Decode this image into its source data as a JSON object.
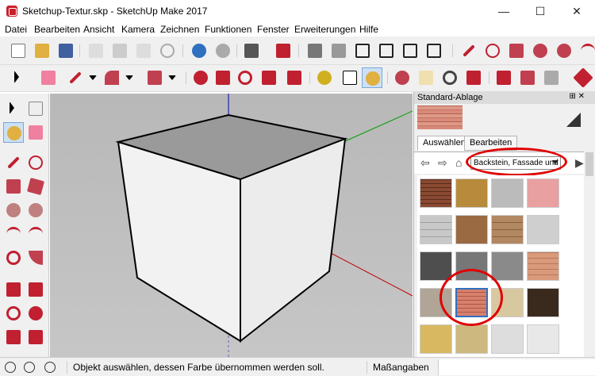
{
  "window": {
    "title": "Sketchup-Textur.skp - SketchUp Make 2017",
    "minimize": "—",
    "maximize": "☐",
    "close": "✕"
  },
  "menu": [
    "Datei",
    "Bearbeiten",
    "Ansicht",
    "Kamera",
    "Zeichnen",
    "Funktionen",
    "Fenster",
    "Erweiterungen",
    "Hilfe"
  ],
  "tray": {
    "title": "Standard-Ablage",
    "tab_select": "Auswählen",
    "tab_edit": "Bearbeiten",
    "collection": "Backstein, Fassade und",
    "pin": "⊞ ✕"
  },
  "status": {
    "message": "Objekt auswählen, dessen Farbe übernommen werden soll.",
    "measure_label": "Maßangaben"
  },
  "colors": {
    "accent_red": "#e00000",
    "axis_red": "#c00000",
    "axis_green": "#00a000",
    "axis_blue": "#0000c0"
  }
}
